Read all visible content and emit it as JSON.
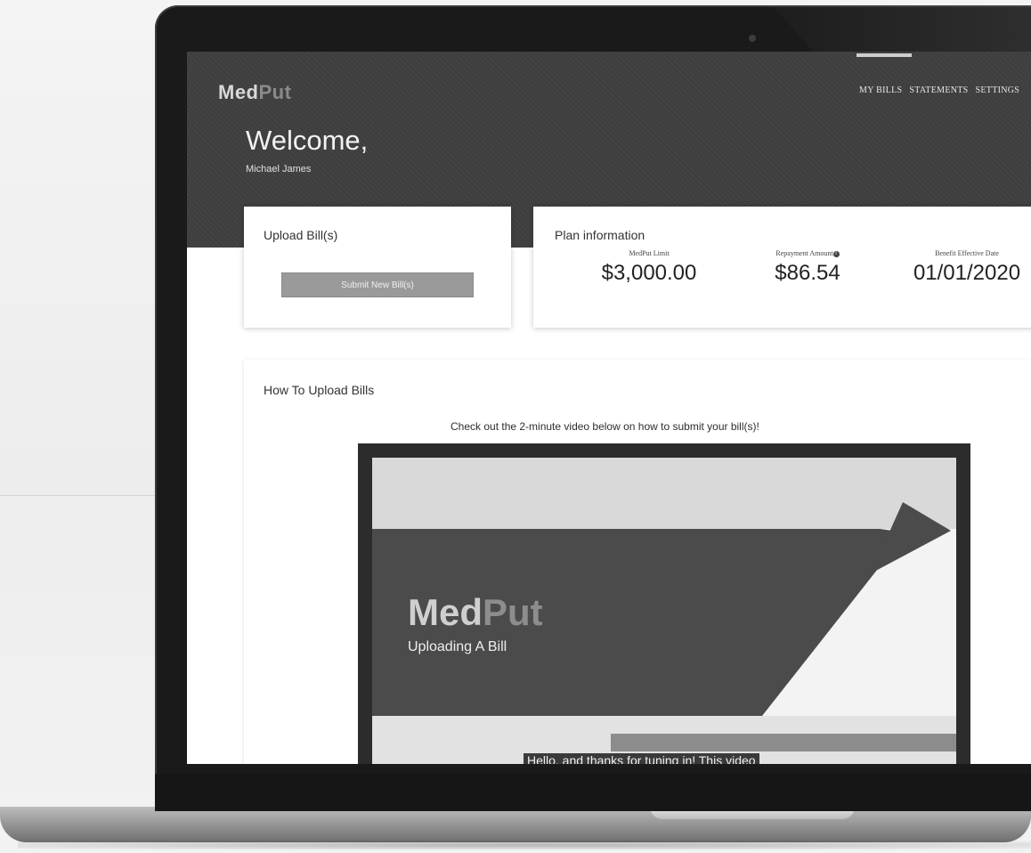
{
  "app": {
    "brand_part1": "Med",
    "brand_part2": "Put"
  },
  "nav": {
    "items": [
      "MY BILLS",
      "STATEMENTS",
      "SETTINGS"
    ]
  },
  "welcome": {
    "heading": "Welcome,",
    "user_name": "Michael James"
  },
  "upload": {
    "title": "Upload Bill(s)",
    "button_label": "Submit New Bill(s)"
  },
  "plan": {
    "title": "Plan information",
    "metrics": [
      {
        "label": "MedPut Limit",
        "value": "$3,000.00"
      },
      {
        "label": "Repayment Amount",
        "value": "$86.54",
        "has_info_icon": true
      },
      {
        "label": "Benefit Effective Date",
        "value": "01/01/2020"
      }
    ]
  },
  "howto": {
    "title": "How To Upload Bills",
    "caption": "Check out the 2-minute video below on how to submit your bill(s)!"
  },
  "video": {
    "brand_part1": "Med",
    "brand_part2": "Put",
    "subtitle": "Uploading A Bill",
    "captions": "Hello, and thanks for tuning in! This video"
  },
  "icons": {
    "info": "info-icon",
    "camera": "camera-icon"
  },
  "colors": {
    "hero_bg": "#4d4d4d",
    "button_bg": "#9a9a9a",
    "bezel": "#1a1a1a"
  }
}
